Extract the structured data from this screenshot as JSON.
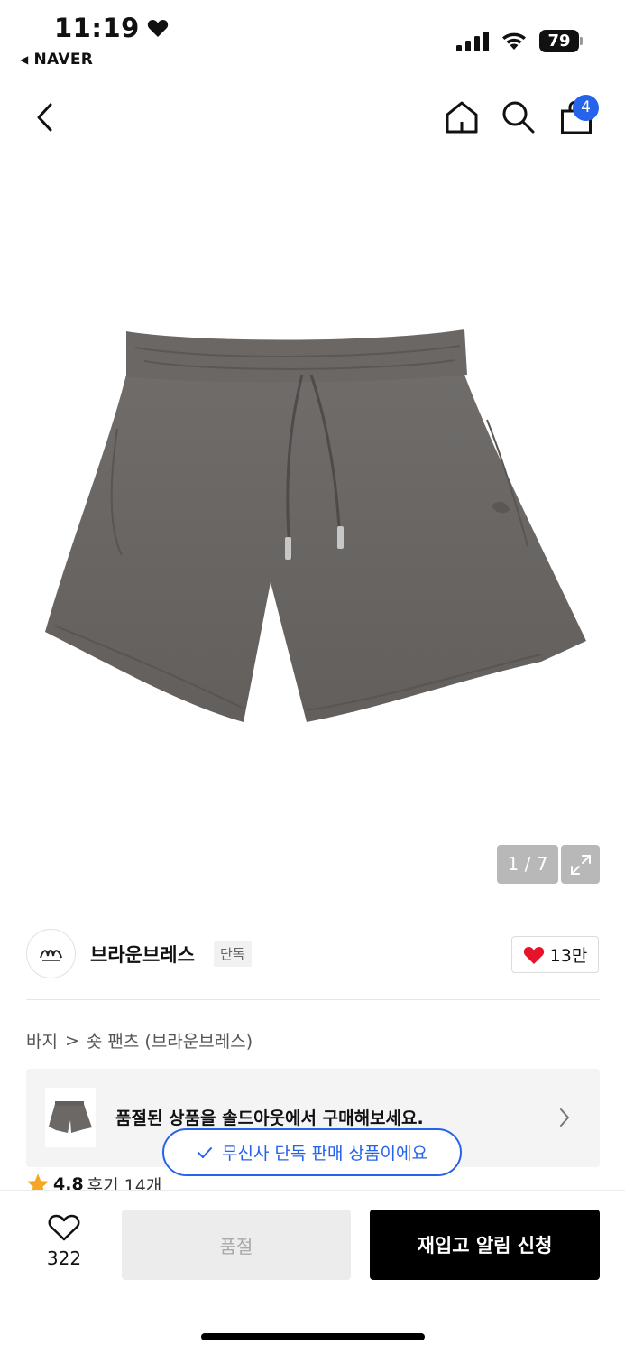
{
  "status_bar": {
    "time": "11:19",
    "back_app": "NAVER",
    "battery": "79"
  },
  "nav": {
    "cart_count": "4"
  },
  "gallery": {
    "page_indicator": "1 / 7"
  },
  "brand": {
    "name": "브라운브레스",
    "tag": "단독",
    "likes": "13만"
  },
  "breadcrumb": {
    "category": "바지",
    "separator": ">",
    "subcategory": "숏 팬츠 (브라운브레스)"
  },
  "soldout_banner": {
    "text": "품절된 상품을 솔드아웃에서 구매해보세요."
  },
  "review": {
    "score": "4.8",
    "label": "후기 14개"
  },
  "toast": {
    "text": "무신사 단독 판매 상품이에요"
  },
  "bottom_bar": {
    "wish_count": "322",
    "soldout_label": "품절",
    "restock_label": "재입고 알림 신청"
  },
  "colors": {
    "accent_blue": "#2563eb",
    "heart_red": "#e5142a",
    "star_orange": "#f5a623",
    "shorts_gray": "#6b6866"
  }
}
